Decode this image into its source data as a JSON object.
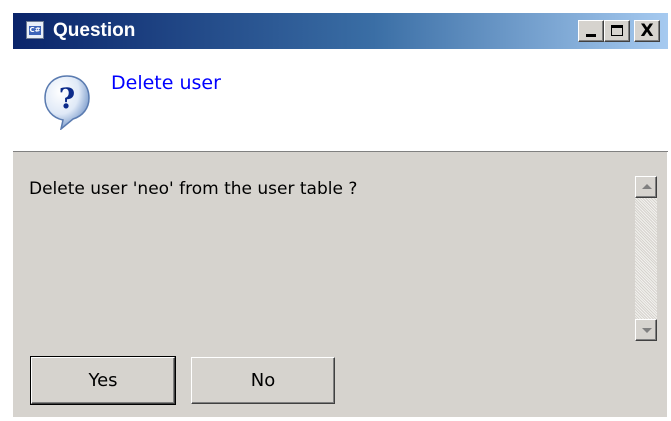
{
  "window": {
    "title": "Question",
    "title_icon": "app-icon",
    "controls": {
      "minimize_icon": "minimize-icon",
      "maximize_icon": "maximize-icon",
      "close_icon": "close-icon",
      "close_glyph": "X"
    }
  },
  "header": {
    "icon": "question-mark-icon",
    "icon_glyph": "?",
    "title": "Delete user"
  },
  "body": {
    "message": "Delete user 'neo' from the user table ?"
  },
  "scrollbar": {
    "up_icon": "scroll-up-arrow-icon",
    "down_icon": "scroll-down-arrow-icon"
  },
  "buttons": {
    "yes": "Yes",
    "no": "No"
  },
  "colors": {
    "title_gradient_start": "#0a246a",
    "title_gradient_end": "#a6caf0",
    "header_title": "#0000ff",
    "dialog_bg": "#d6d3ce"
  }
}
